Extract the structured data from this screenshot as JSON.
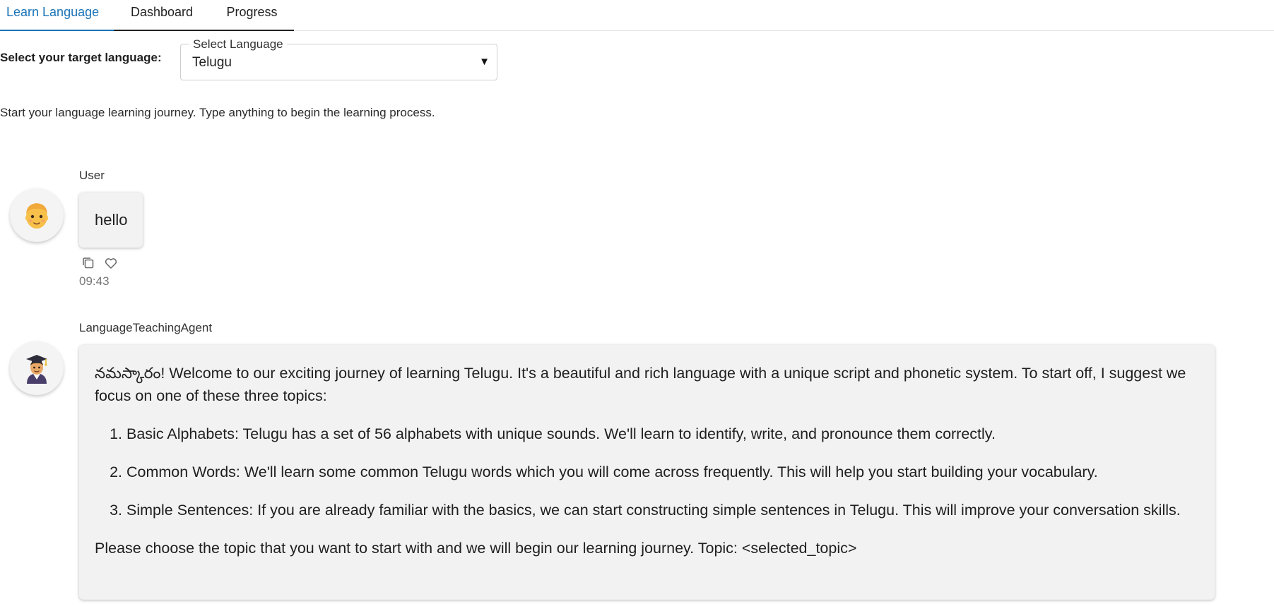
{
  "tabs": {
    "learn": "Learn Language",
    "dashboard": "Dashboard",
    "progress": "Progress"
  },
  "language_select": {
    "label": "Select your target language:",
    "legend": "Select Language",
    "value": "Telugu",
    "caret": "▼"
  },
  "intro": "Start your language learning journey. Type anything to begin the learning process.",
  "messages": {
    "user": {
      "sender": "User",
      "avatar_icon": "person-emoji-icon",
      "text": "hello",
      "time": "09:43"
    },
    "agent": {
      "sender": "LanguageTeachingAgent",
      "avatar_icon": "student-emoji-icon",
      "intro": "నమస్కారం! Welcome to our exciting journey of learning Telugu. It's a beautiful and rich language with a unique script and phonetic system. To start off, I suggest we focus on one of these three topics:",
      "topics": [
        "Basic Alphabets: Telugu has a set of 56 alphabets with unique sounds. We'll learn to identify, write, and pronounce them correctly.",
        "Common Words: We'll learn some common Telugu words which you will come across frequently. This will help you start building your vocabulary.",
        "Simple Sentences: If you are already familiar with the basics, we can start constructing simple sentences in Telugu. This will improve your conversation skills."
      ],
      "closing": "Please choose the topic that you want to start with and we will begin our learning journey. Topic: <selected_topic>"
    }
  },
  "colors": {
    "accent": "#1a73b8",
    "bubble": "#f2f2f2"
  }
}
